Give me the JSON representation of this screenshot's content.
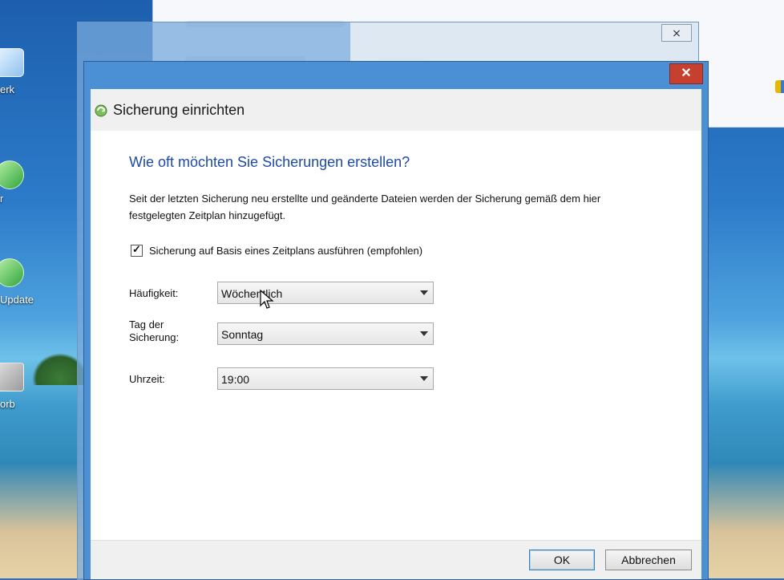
{
  "desktop": {
    "icons": [
      {
        "label": "erk"
      },
      {
        "label": "r"
      },
      {
        "label": "Update"
      },
      {
        "label": "orb"
      }
    ]
  },
  "background_window": {
    "blurred": true
  },
  "middle_window": {
    "close_glyph": "⨯"
  },
  "dialog": {
    "title": "Sicherung einrichten",
    "close_glyph": "✕",
    "heading": "Wie oft möchten Sie Sicherungen erstellen?",
    "description": "Seit der letzten Sicherung neu erstellte und geänderte Dateien werden der Sicherung gemäß dem hier festgelegten Zeitplan hinzugefügt.",
    "schedule_checkbox": {
      "label": "Sicherung auf Basis eines Zeitplans ausführen (empfohlen)",
      "checked": true,
      "mark": "✓"
    },
    "fields": {
      "frequency": {
        "label": "Häufigkeit:",
        "value": "Wöchentlich"
      },
      "day": {
        "label_line1": "Tag der",
        "label_line2": "Sicherung:",
        "value": "Sonntag"
      },
      "time": {
        "label": "Uhrzeit:",
        "value": "19:00"
      }
    },
    "buttons": {
      "ok": "OK",
      "cancel": "Abbrechen"
    }
  },
  "colors": {
    "heading": "#1f4aa6",
    "titlebar": "#4b8fd4",
    "close_button": "#c7402f"
  }
}
